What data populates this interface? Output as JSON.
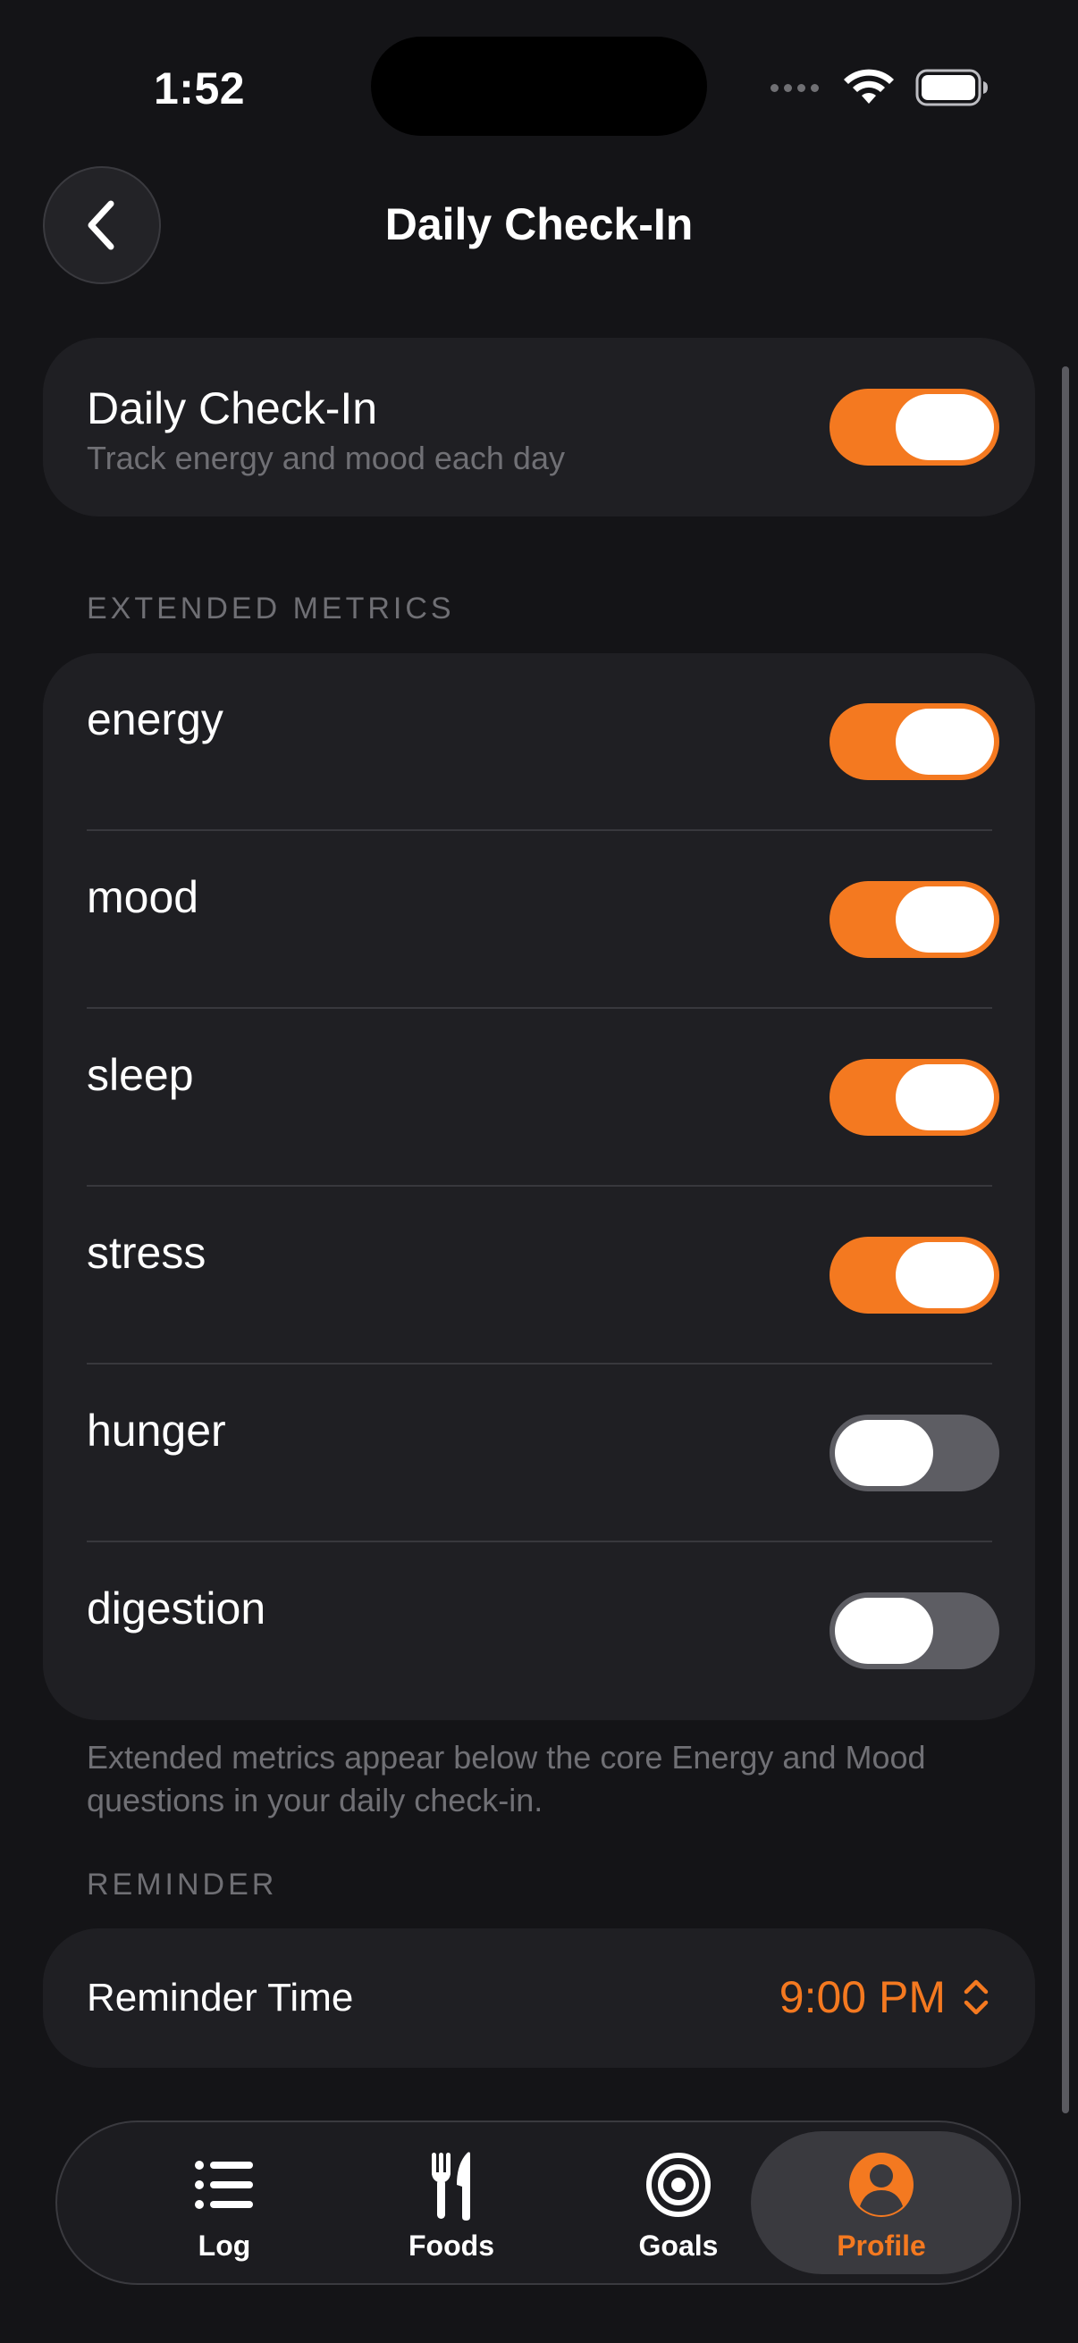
{
  "status_bar": {
    "time": "1:52"
  },
  "header": {
    "title": "Daily Check-In"
  },
  "daily_checkin": {
    "title": "Daily Check-In",
    "subtitle": "Track energy and mood each day",
    "enabled": true
  },
  "extended_metrics": {
    "section_label": "EXTENDED METRICS",
    "items": [
      {
        "label": "energy",
        "enabled": true
      },
      {
        "label": "mood",
        "enabled": true
      },
      {
        "label": "sleep",
        "enabled": true
      },
      {
        "label": "stress",
        "enabled": true
      },
      {
        "label": "hunger",
        "enabled": false
      },
      {
        "label": "digestion",
        "enabled": false
      }
    ],
    "footnote": "Extended metrics appear below the core Energy and Mood questions in your daily check-in."
  },
  "reminder": {
    "section_label": "REMINDER",
    "label": "Reminder Time",
    "value": "9:00 PM"
  },
  "tab_bar": {
    "tabs": [
      {
        "label": "Log",
        "icon": "list-icon"
      },
      {
        "label": "Foods",
        "icon": "fork-knife-icon"
      },
      {
        "label": "Goals",
        "icon": "target-icon"
      },
      {
        "label": "Profile",
        "icon": "profile-icon",
        "active": true
      }
    ]
  },
  "colors": {
    "accent": "#f47920",
    "background": "#141417",
    "card": "#1f1f23"
  }
}
